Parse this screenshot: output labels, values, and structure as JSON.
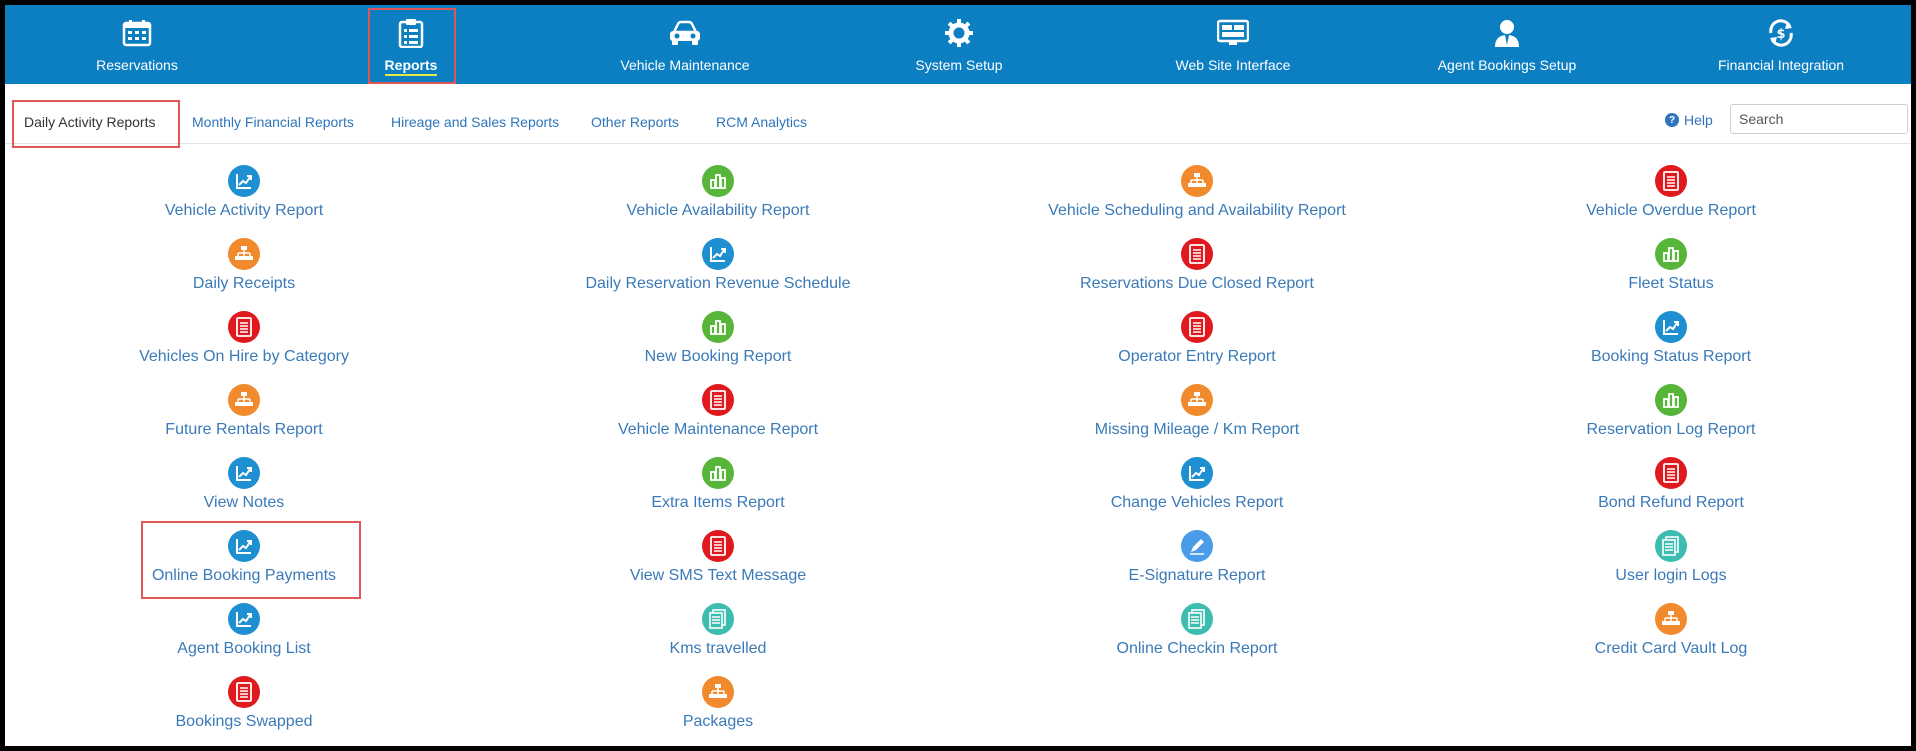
{
  "topnav": {
    "items": [
      {
        "label": "Reservations",
        "icon": "calendar-icon"
      },
      {
        "label": "Reports",
        "icon": "clipboard-icon"
      },
      {
        "label": "Vehicle Maintenance",
        "icon": "car-icon"
      },
      {
        "label": "System Setup",
        "icon": "gear-icon"
      },
      {
        "label": "Web Site Interface",
        "icon": "monitor-icon"
      },
      {
        "label": "Agent Bookings Setup",
        "icon": "user-icon"
      },
      {
        "label": "Financial Integration",
        "icon": "dollar-sync-icon"
      }
    ],
    "bg_color": "#0c7ec2"
  },
  "subtabs": {
    "items": [
      {
        "label": "Daily Activity Reports"
      },
      {
        "label": "Monthly Financial Reports"
      },
      {
        "label": "Hireage and Sales Reports"
      },
      {
        "label": "Other Reports"
      },
      {
        "label": "RCM Analytics"
      }
    ],
    "help_label": "Help",
    "search_placeholder": "Search"
  },
  "reports": {
    "col1": [
      {
        "label": "Vehicle Activity Report",
        "icon": "chart-line-icon",
        "color": "#1e8fd1"
      },
      {
        "label": "Daily Receipts",
        "icon": "hierarchy-icon",
        "color": "#f08a2c"
      },
      {
        "label": "Vehicles On Hire by Category",
        "icon": "document-icon",
        "color": "#e0191f"
      },
      {
        "label": "Future Rentals Report",
        "icon": "hierarchy-icon",
        "color": "#f08a2c"
      },
      {
        "label": "View Notes",
        "icon": "chart-line-icon",
        "color": "#1e8fd1"
      },
      {
        "label": "Online Booking Payments",
        "icon": "chart-line-icon",
        "color": "#1e8fd1"
      },
      {
        "label": "Agent Booking List",
        "icon": "chart-line-icon",
        "color": "#1e8fd1"
      },
      {
        "label": "Bookings Swapped",
        "icon": "document-icon",
        "color": "#e0191f"
      }
    ],
    "col2": [
      {
        "label": "Vehicle Availability Report",
        "icon": "bar-chart-icon",
        "color": "#57b63a"
      },
      {
        "label": "Daily Reservation Revenue Schedule",
        "icon": "chart-line-icon",
        "color": "#1e8fd1"
      },
      {
        "label": "New Booking Report",
        "icon": "bar-chart-icon",
        "color": "#57b63a"
      },
      {
        "label": "Vehicle Maintenance Report",
        "icon": "document-icon",
        "color": "#e0191f"
      },
      {
        "label": "Extra Items Report",
        "icon": "bar-chart-icon",
        "color": "#57b63a"
      },
      {
        "label": "View SMS Text Message",
        "icon": "document-icon",
        "color": "#e0191f"
      },
      {
        "label": "Kms travelled",
        "icon": "list-document-icon",
        "color": "#3dbdb0"
      },
      {
        "label": "Packages",
        "icon": "hierarchy-icon",
        "color": "#f08a2c"
      }
    ],
    "col3": [
      {
        "label": "Vehicle Scheduling and Availability Report",
        "icon": "hierarchy-icon",
        "color": "#f08a2c"
      },
      {
        "label": "Reservations Due Closed Report",
        "icon": "document-icon",
        "color": "#e0191f"
      },
      {
        "label": "Operator Entry Report",
        "icon": "document-icon",
        "color": "#e0191f"
      },
      {
        "label": "Missing Mileage / Km Report",
        "icon": "hierarchy-icon",
        "color": "#f08a2c"
      },
      {
        "label": "Change Vehicles Report",
        "icon": "chart-line-icon",
        "color": "#1e8fd1"
      },
      {
        "label": "E-Signature Report",
        "icon": "pen-icon",
        "color": "#4a9be8"
      },
      {
        "label": "Online Checkin Report",
        "icon": "list-document-icon",
        "color": "#3dbdb0"
      }
    ],
    "col4": [
      {
        "label": "Vehicle Overdue Report",
        "icon": "document-icon",
        "color": "#e0191f"
      },
      {
        "label": "Fleet Status",
        "icon": "bar-chart-icon",
        "color": "#57b63a"
      },
      {
        "label": "Booking Status Report",
        "icon": "chart-line-icon",
        "color": "#1e8fd1"
      },
      {
        "label": "Reservation Log Report",
        "icon": "bar-chart-icon",
        "color": "#57b63a"
      },
      {
        "label": "Bond Refund Report",
        "icon": "document-icon",
        "color": "#e0191f"
      },
      {
        "label": "User login Logs",
        "icon": "list-document-icon",
        "color": "#3dbdb0"
      },
      {
        "label": "Credit Card Vault Log",
        "icon": "hierarchy-icon",
        "color": "#f08a2c"
      }
    ]
  }
}
